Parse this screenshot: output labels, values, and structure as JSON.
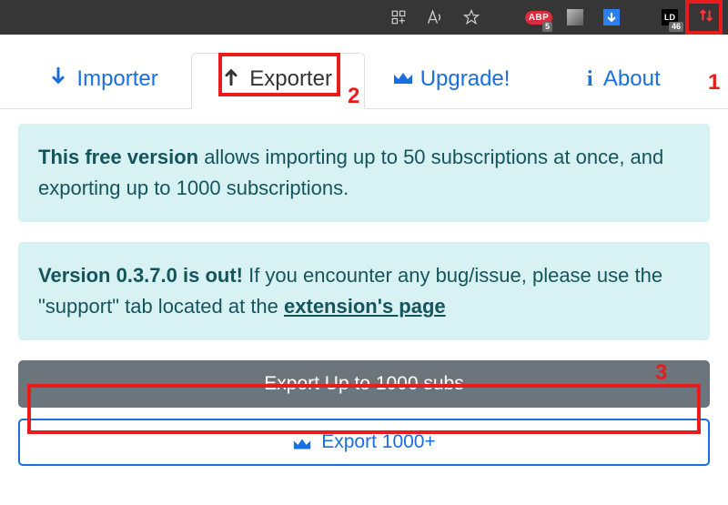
{
  "browser_bar": {
    "abp_label": "ABP",
    "abp_badge": "5",
    "ld_label": "LD",
    "ld_badge": "46"
  },
  "tabs": {
    "importer": "Importer",
    "exporter": "Exporter",
    "upgrade": "Upgrade!",
    "about": "About"
  },
  "alerts": {
    "free": {
      "bold": "This free version",
      "rest": " allows importing up to 50 subscriptions at once, and exporting up to 1000 subscriptions."
    },
    "version": {
      "bold": "Version 0.3.7.0 is out!",
      "middle": " If you encounter any bug/issue, please use the \"support\" tab located at the ",
      "link": "extension's page"
    }
  },
  "buttons": {
    "export_free": "Export Up to 1000 subs",
    "export_premium": "Export 1000+"
  },
  "annotations": {
    "n1": "1",
    "n2": "2",
    "n3": "3"
  }
}
